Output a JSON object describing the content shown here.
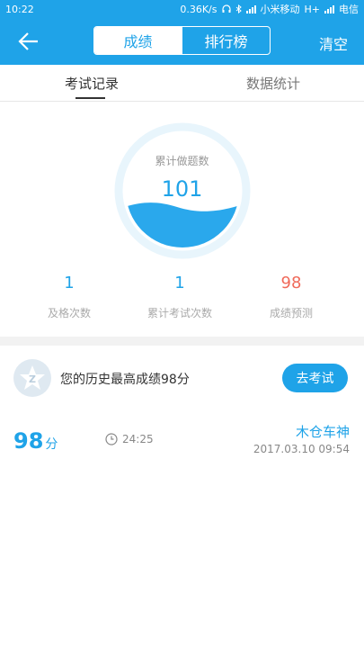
{
  "status": {
    "time": "10:22",
    "speed": "0.36K/s",
    "carrier1": "小米移动",
    "net": "H+",
    "carrier2": "电信"
  },
  "nav": {
    "back_icon": "arrow-left-icon",
    "tabs": [
      "成绩",
      "排行榜"
    ],
    "active_tab": 0,
    "clear_label": "清空"
  },
  "subtabs": {
    "items": [
      "考试记录",
      "数据统计"
    ],
    "active": 0
  },
  "summary": {
    "gauge_label": "累计做题数",
    "gauge_value": "101",
    "stats": [
      {
        "value": "1",
        "label": "及格次数"
      },
      {
        "value": "1",
        "label": "累计考试次数"
      },
      {
        "value": "98",
        "label": "成绩预测"
      }
    ]
  },
  "best": {
    "text": "您的历史最高成绩98分",
    "button": "去考试"
  },
  "record": {
    "score": "98",
    "unit": "分",
    "duration": "24:25",
    "name": "木仓车神",
    "date": "2017.03.10  09:54"
  },
  "colors": {
    "primary": "#1fa3e8",
    "warn": "#f06a5a"
  }
}
